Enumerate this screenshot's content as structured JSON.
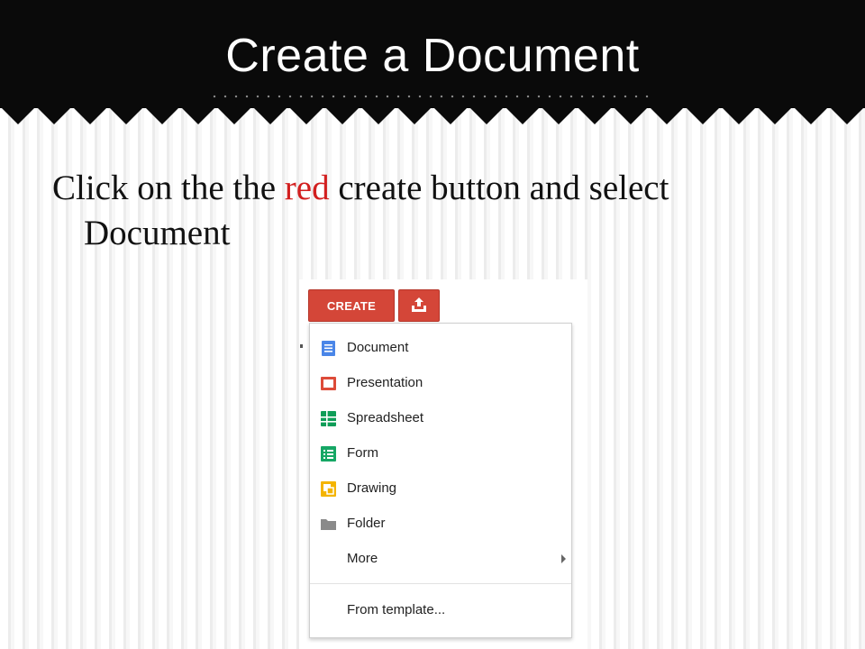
{
  "slide": {
    "title": "Create a Document",
    "instruction": {
      "part1": "Click on the the ",
      "highlight": "red",
      "part2": " create button and select",
      "line2": "Document"
    }
  },
  "drive": {
    "create_label": "CREATE",
    "upload_icon": "upload-icon",
    "menu": [
      {
        "label": "Document",
        "icon": "document-icon"
      },
      {
        "label": "Presentation",
        "icon": "presentation-icon"
      },
      {
        "label": "Spreadsheet",
        "icon": "spreadsheet-icon"
      },
      {
        "label": "Form",
        "icon": "form-icon"
      },
      {
        "label": "Drawing",
        "icon": "drawing-icon"
      },
      {
        "label": "Folder",
        "icon": "folder-icon"
      },
      {
        "label": "More",
        "icon": "submenu-arrow-icon"
      },
      {
        "label": "From template...",
        "icon": ""
      }
    ]
  },
  "colors": {
    "header_bg": "#0a0a0a",
    "accent_red": "#d21f1f",
    "create_button": "#d44638",
    "doc_blue": "#4a86e8",
    "slides_red": "#dd4b39",
    "sheets_green": "#0f9d58",
    "form_green": "#16a765",
    "drawing_yellow": "#f4b400",
    "folder_gray": "#8a8a8a"
  }
}
